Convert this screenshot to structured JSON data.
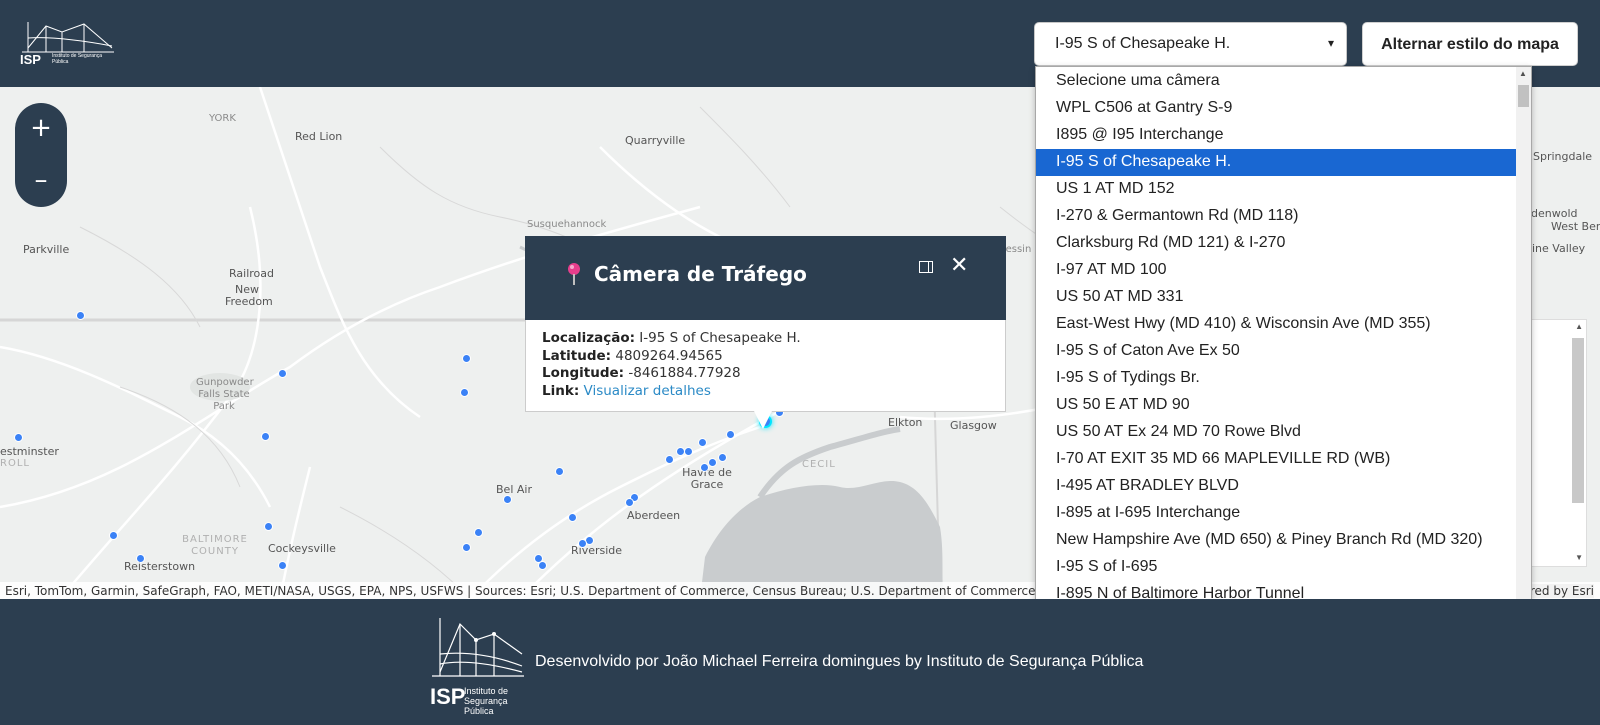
{
  "header": {
    "logo_text": "ISP",
    "logo_sub": "Instituto de Segurança Pública",
    "camera_select_value": "I-95 S of Chesapeake H.",
    "style_button_label": "Alternar estilo do mapa"
  },
  "map": {
    "zoom_in": "+",
    "zoom_out": "–",
    "places": [
      "YORK",
      "Red Lion",
      "Quarryville",
      "Parkville",
      "Railroad",
      "New Freedom",
      "Susquehannock",
      "Gunpowder Falls State Park",
      "Bel Air",
      "Havre de Grace",
      "Aberdeen",
      "Riverside",
      "BALTIMORE COUNTY",
      "Cockeysville",
      "Reisterstown",
      "estminster",
      "ROLL",
      "Elkton",
      "Glasgow",
      "CECIL",
      "Springdale",
      "denwold",
      "West Berl",
      "ine Valley",
      "keessin"
    ],
    "attribution": "Esri, TomTom, Garmin, SafeGraph, FAO, METI/NASA, USGS, EPA, NPS, USFWS | Sources: Esri; U.S. Department of Commerce, Census Bureau; U.S. Department of Commerce (DOC),",
    "attribution_right": "ered by Esri"
  },
  "popup": {
    "title": "Câmera de Tráfego",
    "location_label": "Localização:",
    "location_value": "I-95 S of Chesapeake H.",
    "latitude_label": "Latitude:",
    "latitude_value": "4809264.94565",
    "longitude_label": "Longitude:",
    "longitude_value": "-8461884.77928",
    "link_label": "Link:",
    "link_text": "Visualizar detalhes",
    "dock_icon": "dock-icon",
    "close_icon": "close-icon"
  },
  "dropdown": {
    "options": [
      "Selecione uma câmera",
      "WPL C506 at Gantry S-9",
      "I895 @ I95 Interchange",
      "I-95 S of Chesapeake H.",
      "US 1 AT MD 152",
      "I-270 & Germantown Rd (MD 118)",
      "Clarksburg Rd (MD 121) & I-270",
      "I-97 AT MD 100",
      "US 50 AT MD 331",
      "East-West Hwy (MD 410) & Wisconsin Ave (MD 355)",
      "I-95 S of Caton Ave Ex 50",
      "I-95 S of Tydings Br.",
      "US 50 E AT MD 90",
      "US 50 AT Ex 24 MD 70 Rowe Blvd",
      "I-70 AT EXIT 35 MD 66 MAPLEVILLE RD (WB)",
      "I-495 AT BRADLEY BLVD",
      "I-895 at I-695 Interchange",
      "New Hampshire Ave (MD 650) & Piney Branch Rd (MD 320)",
      "I-95 S of I-695",
      "I-895 N of Baltimore Harbor Tunnel"
    ],
    "selected_index": 3,
    "selected_color": "#1967d2"
  },
  "footer": {
    "logo_text": "ISP",
    "logo_sub": "Instituto de Segurança Pública",
    "text": "Desenvolvido por João Michael Ferreira domingues by Instituto de Segurança Pública"
  },
  "colors": {
    "brand_dark": "#2c3e50",
    "marker_blue": "#3b82f6",
    "link_blue": "#2b8ac6",
    "pin_pink": "#e83e8c"
  }
}
